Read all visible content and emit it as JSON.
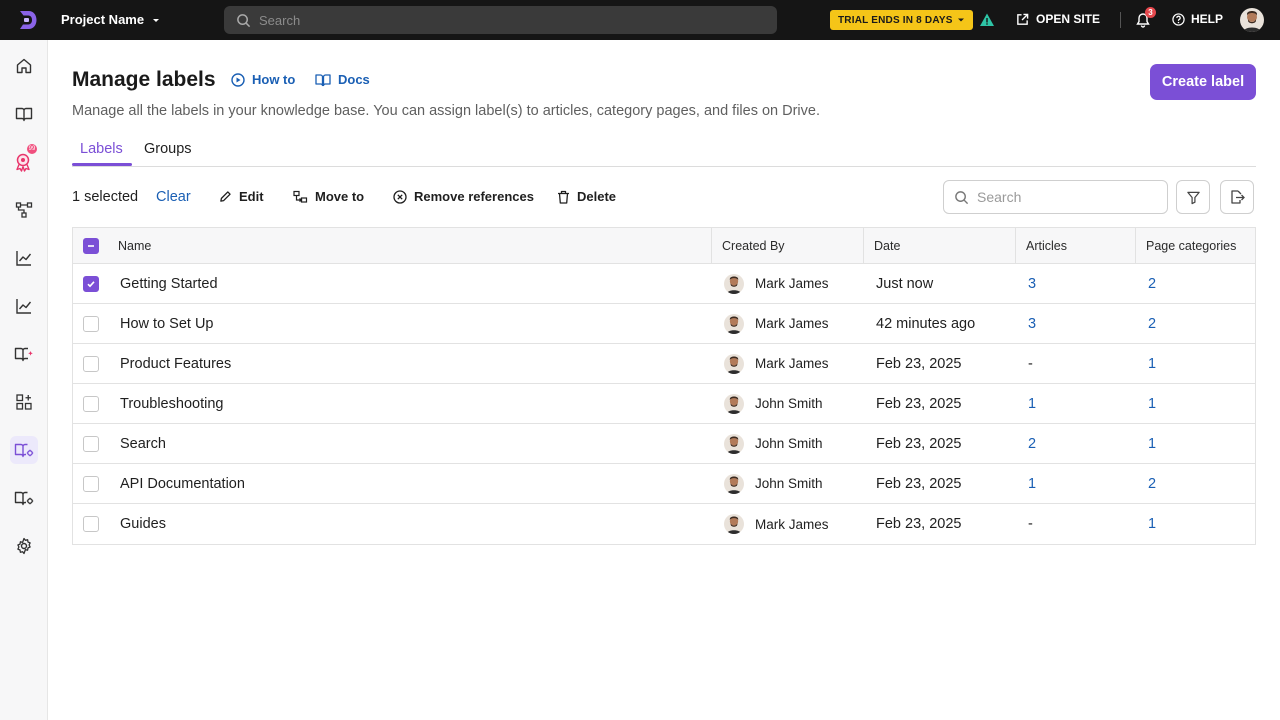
{
  "topbar": {
    "project_name": "Project Name",
    "search_placeholder": "Search",
    "trial_label": "TRIAL ENDS IN 8 DAYS",
    "open_site_label": "OPEN SITE",
    "notification_count": "3",
    "help_label": "HELP"
  },
  "sidebar": {
    "items": [
      {
        "icon": "home-icon"
      },
      {
        "icon": "book-icon"
      },
      {
        "icon": "badge-icon",
        "badge": "99"
      },
      {
        "icon": "workflow-icon"
      },
      {
        "icon": "analytics-icon"
      },
      {
        "icon": "analytics-icon"
      },
      {
        "icon": "ai-book-icon"
      },
      {
        "icon": "apps-icon"
      },
      {
        "icon": "knowledge-settings-icon",
        "active": true
      },
      {
        "icon": "book-settings-icon"
      },
      {
        "icon": "settings-icon"
      }
    ]
  },
  "page": {
    "title": "Manage labels",
    "how_to_label": "How to",
    "docs_label": "Docs",
    "description": "Manage all the labels in your knowledge base. You can assign label(s) to articles, category pages, and files on Drive.",
    "create_button": "Create label"
  },
  "tabs": [
    {
      "label": "Labels",
      "active": true
    },
    {
      "label": "Groups",
      "active": false
    }
  ],
  "toolbar": {
    "selected_text": "1 selected",
    "clear_label": "Clear",
    "edit_label": "Edit",
    "move_label": "Move to",
    "remove_label": "Remove references",
    "delete_label": "Delete",
    "search_placeholder": "Search"
  },
  "table": {
    "columns": [
      "Name",
      "Created By",
      "Date",
      "Articles",
      "Page categories"
    ],
    "rows": [
      {
        "name": "Getting Started",
        "created_by": "Mark James",
        "date": "Just now",
        "articles": "3",
        "page_categories": "2",
        "checked": true
      },
      {
        "name": "How to Set Up",
        "created_by": "Mark James",
        "date": "42 minutes ago",
        "articles": "3",
        "page_categories": "2",
        "checked": false
      },
      {
        "name": "Product Features",
        "created_by": "Mark James",
        "date": "Feb 23, 2025",
        "articles": "-",
        "page_categories": "1",
        "checked": false
      },
      {
        "name": "Troubleshooting",
        "created_by": "John Smith",
        "date": "Feb 23, 2025",
        "articles": "1",
        "page_categories": "1",
        "checked": false
      },
      {
        "name": "Search",
        "created_by": "John Smith",
        "date": "Feb 23, 2025",
        "articles": "2",
        "page_categories": "1",
        "checked": false
      },
      {
        "name": "API Documentation",
        "created_by": "John Smith",
        "date": "Feb 23, 2025",
        "articles": "1",
        "page_categories": "2",
        "checked": false
      },
      {
        "name": "Guides",
        "created_by": "Mark James",
        "date": "Feb 23, 2025",
        "articles": "-",
        "page_categories": "1",
        "checked": false
      }
    ]
  },
  "colors": {
    "accent": "#7b4fd6",
    "link": "#1a5fb4",
    "topbar": "#151515",
    "trial": "#f5c518"
  }
}
